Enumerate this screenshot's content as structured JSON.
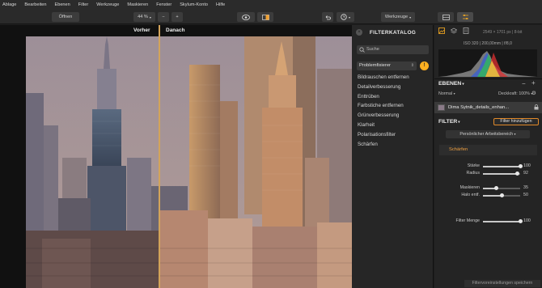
{
  "menu": [
    "Ablage",
    "Bearbeiten",
    "Ebenen",
    "Filter",
    "Werkzeuge",
    "Maskieren",
    "Fenster",
    "Skylum-Konto",
    "Hilfe"
  ],
  "toolbar": {
    "open_label": "Öffnen",
    "zoom_label": "44 %",
    "zoom_minus": "−",
    "zoom_plus": "+",
    "tools_label": "Werkzeuge"
  },
  "canvas": {
    "before_label": "Vorher",
    "after_label": "Danach"
  },
  "catalog": {
    "title": "FILTERKATALOG",
    "search_placeholder": "Suche",
    "category": "Problemfixierer",
    "filters": [
      "Bildrauschen entfernen",
      "Detailverbesserung",
      "Enttrüben",
      "Farbstiche entfernen",
      "Grünverbesserung",
      "Klarheit",
      "Polarisationsfilter",
      "Schärfen"
    ]
  },
  "info": {
    "dimensions": "2549 × 1701 px  |  8-bit",
    "exif": "ISO 320  |  200,00mm  |  f/8,0"
  },
  "layers": {
    "title": "EBENEN",
    "blend_mode": "Normal",
    "opacity_label": "Deckkraft: 100%",
    "layer_name": "Dima Sytnik_details_enhan..."
  },
  "filter_section": {
    "title": "FILTER",
    "add_button": "Filter hinzufügen",
    "preset_label": "Persönlicher Arbeitsbereich",
    "active_filter": "Schärfen",
    "sliders": [
      {
        "name": "Stärke",
        "value": 100,
        "fraction": 1.0
      },
      {
        "name": "Radius",
        "value": 92,
        "fraction": 0.92
      },
      {
        "name": "Maskieren",
        "value": 35,
        "fraction": 0.35
      },
      {
        "name": "Halo entf.",
        "value": 50,
        "fraction": 0.5
      }
    ],
    "amount_slider": {
      "name": "Filter Menge",
      "value": 100,
      "fraction": 1.0
    },
    "save_label": "Filtervoreinstellungen speichern"
  },
  "colors": {
    "accent": "#e28a2a",
    "split_line": "#d3a45a",
    "highlight": "#ffb020"
  }
}
